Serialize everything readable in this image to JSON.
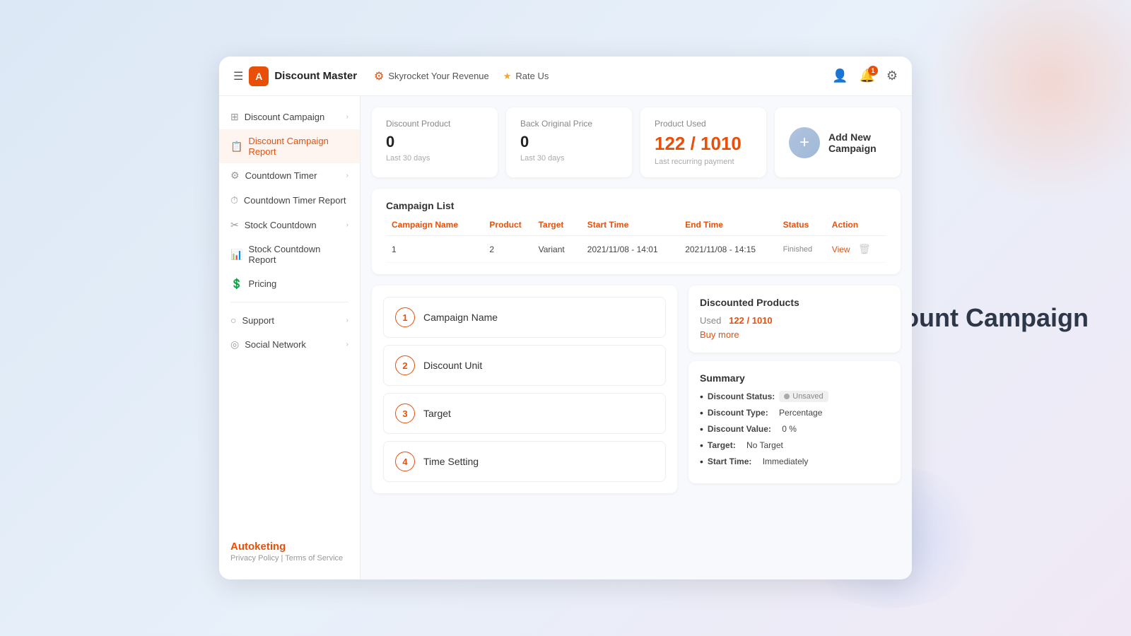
{
  "page_title_aside": "Discount Campaign",
  "header": {
    "hamburger": "☰",
    "logo_letter": "A",
    "app_title": "Discount Master",
    "nav_items": [
      {
        "icon": "⚙",
        "label": "Skyrocket Your Revenue",
        "icon_type": "orange"
      },
      {
        "icon": "★",
        "label": "Rate Us",
        "icon_type": "star"
      }
    ],
    "icons": {
      "user": "👤",
      "bell": "🔔",
      "notif_count": "1",
      "settings": "⚙"
    }
  },
  "sidebar": {
    "items": [
      {
        "label": "Discount Campaign",
        "icon": "⊞",
        "has_arrow": true,
        "active": false,
        "name": "discount-campaign"
      },
      {
        "label": "Discount Campaign Report",
        "icon": "📋",
        "has_arrow": false,
        "active": true,
        "name": "discount-campaign-report"
      },
      {
        "label": "Countdown Timer",
        "icon": "⚙",
        "has_arrow": true,
        "active": false,
        "name": "countdown-timer"
      },
      {
        "label": "Countdown Timer Report",
        "icon": "⏱",
        "has_arrow": false,
        "active": false,
        "name": "countdown-timer-report"
      },
      {
        "label": "Stock Countdown",
        "icon": "✂",
        "has_arrow": true,
        "active": false,
        "name": "stock-countdown"
      },
      {
        "label": "Stock Countdown Report",
        "icon": "📊",
        "has_arrow": false,
        "active": false,
        "name": "stock-countdown-report"
      },
      {
        "label": "Pricing",
        "icon": "💲",
        "has_arrow": false,
        "active": false,
        "name": "pricing"
      }
    ],
    "section2": [
      {
        "label": "Support",
        "icon": "○",
        "has_arrow": true,
        "name": "support"
      },
      {
        "label": "Social Network",
        "icon": "◎",
        "has_arrow": true,
        "name": "social-network"
      }
    ],
    "brand": "Autoketing",
    "privacy_link": "Privacy Policy",
    "terms_link": "Terms of Service"
  },
  "stats": {
    "discount_product": {
      "label": "Discount Product",
      "value": "0",
      "sub": "Last 30 days"
    },
    "back_original": {
      "label": "Back Original Price",
      "value": "0",
      "sub": "Last 30 days"
    },
    "product_used": {
      "label": "Product Used",
      "value": "122 / 1010",
      "sub": "Last recurring payment"
    },
    "add_new": {
      "plus": "+",
      "label": "Add New Campaign"
    }
  },
  "campaign_list": {
    "title": "Campaign List",
    "columns": [
      "Campaign Name",
      "Product",
      "Target",
      "Start Time",
      "End Time",
      "Status",
      "Action"
    ],
    "rows": [
      {
        "name": "1",
        "product": "2",
        "target": "Variant",
        "start_time": "2021/11/08 - 14:01",
        "end_time": "2021/11/08 - 14:15",
        "status": "Finished",
        "action_view": "View",
        "action_delete": "🗑"
      }
    ]
  },
  "form_steps": {
    "steps": [
      {
        "num": "1",
        "label": "Campaign Name"
      },
      {
        "num": "2",
        "label": "Discount Unit"
      },
      {
        "num": "3",
        "label": "Target"
      },
      {
        "num": "4",
        "label": "Time Setting"
      }
    ]
  },
  "discounted_products": {
    "title": "Discounted Products",
    "used_label": "Used",
    "used_value": "122 / 1010",
    "buy_more": "Buy more"
  },
  "summary": {
    "title": "Summary",
    "items": [
      {
        "key": "Discount Status:",
        "value": "Unsaved",
        "is_badge": true
      },
      {
        "key": "Discount Type:",
        "value": "Percentage"
      },
      {
        "key": "Discount Value:",
        "value": "0 %"
      },
      {
        "key": "Target:",
        "value": "No Target"
      },
      {
        "key": "Start Time:",
        "value": "Immediately"
      }
    ]
  }
}
